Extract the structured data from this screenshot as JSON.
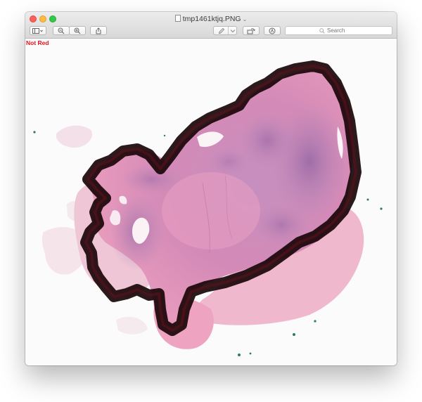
{
  "window": {
    "title": "tmp1461ktjq.PNG",
    "title_chevron": "⌄"
  },
  "toolbar": {
    "search_placeholder": "Search"
  },
  "overlay": {
    "label": "Not Red",
    "label_color": "#e3161b"
  },
  "icons": {
    "sidebar": "sidebar-icon",
    "zoom_out": "zoom-out-icon",
    "zoom_in": "zoom-in-icon",
    "share": "share-icon",
    "markup_pen": "pen-icon",
    "rotate": "rotate-icon",
    "annotate": "markup-icon",
    "search": "search-icon"
  },
  "colors": {
    "tissue_pink": "#e590b5",
    "tumor_purple": "#b87fb4",
    "outline_dark": "#1a0508"
  }
}
